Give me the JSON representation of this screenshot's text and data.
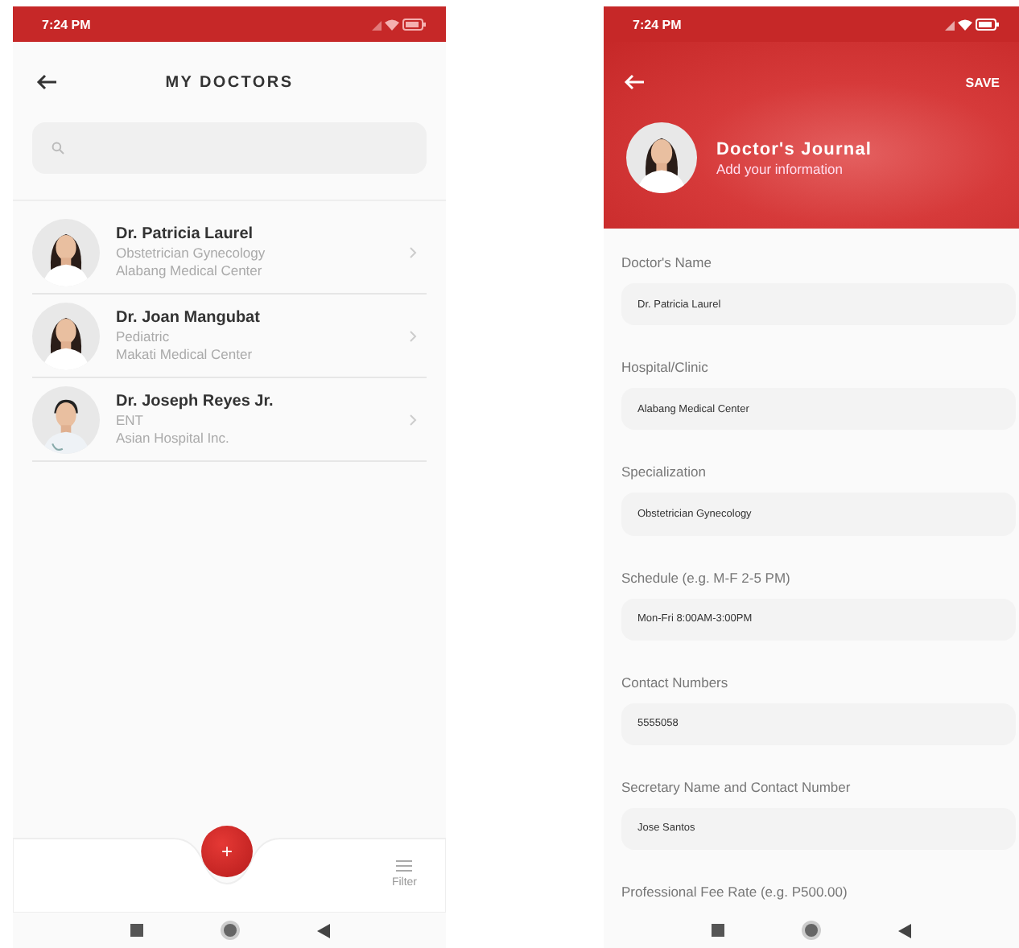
{
  "doctor_list": {
    "status_bar": {
      "time": "7:24 PM"
    },
    "title": "MY DOCTORS",
    "doctors": [
      {
        "name": "Dr. Patricia Laurel",
        "specialty": "Obstetrician Gynecology",
        "hospital": "Alabang Medical Center"
      },
      {
        "name": "Dr. Joan Mangubat",
        "specialty": "Pediatric",
        "hospital": "Makati Medical Center"
      },
      {
        "name": "Dr. Joseph Reyes Jr.",
        "specialty": "ENT",
        "hospital": "Asian Hospital Inc."
      }
    ],
    "fab_label": "+",
    "filter_label": "Filter"
  },
  "doctor_form": {
    "status_bar": {
      "time": "7:24 PM"
    },
    "save_label": "SAVE",
    "title": "Doctor's Journal",
    "subtitle": "Add your information",
    "fields": [
      {
        "label": "Doctor's Name",
        "value": "Dr. Patricia Laurel"
      },
      {
        "label": "Hospital/Clinic",
        "value": "Alabang Medical Center"
      },
      {
        "label": "Specialization",
        "value": "Obstetrician Gynecology"
      },
      {
        "label": "Schedule (e.g. M-F 2-5 PM)",
        "value": "Mon-Fri 8:00AM-3:00PM"
      },
      {
        "label": "Contact Numbers",
        "value": "5555058"
      },
      {
        "label": "Secretary Name and Contact Number",
        "value": "Jose Santos"
      },
      {
        "label": "Professional Fee Rate (e.g. P500.00)"
      }
    ]
  }
}
